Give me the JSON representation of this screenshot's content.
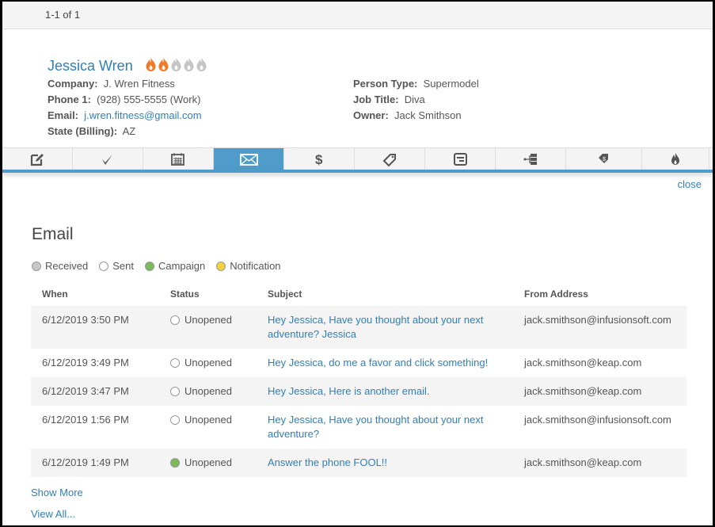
{
  "pager": "1-1 of 1",
  "contact": {
    "name": "Jessica Wren",
    "score": 2,
    "score_max": 5,
    "left": [
      {
        "label": "Company:",
        "value": "J. Wren Fitness"
      },
      {
        "label": "Phone 1:",
        "value": "(928) 555-5555 (Work)"
      },
      {
        "label": "Email:",
        "value": "j.wren.fitness@gmail.com",
        "link": true
      },
      {
        "label": "State (Billing):",
        "value": "AZ"
      }
    ],
    "right": [
      {
        "label": "Person Type:",
        "value": "Supermodel"
      },
      {
        "label": "Job Title:",
        "value": "Diva"
      },
      {
        "label": "Owner:",
        "value": "Jack Smithson"
      }
    ]
  },
  "tabs": [
    "note",
    "task",
    "appointment",
    "email",
    "payment",
    "tag",
    "form",
    "sequence",
    "promo",
    "score"
  ],
  "active_tab": "email",
  "close": "close",
  "email": {
    "title": "Email",
    "legend": [
      {
        "label": "Received",
        "color": "#c8c8c8"
      },
      {
        "label": "Sent",
        "color": "#ffffff"
      },
      {
        "label": "Campaign",
        "color": "#7cb95b"
      },
      {
        "label": "Notification",
        "color": "#f2d23a"
      }
    ],
    "columns": [
      "When",
      "Status",
      "Subject",
      "From Address"
    ],
    "rows": [
      {
        "when": "6/12/2019 3:50 PM",
        "status": "Unopened",
        "dot": "#ffffff",
        "subject": "Hey Jessica, Have you thought about your next adventure? Jessica",
        "from": "jack.smithson@infusionsoft.com"
      },
      {
        "when": "6/12/2019 3:49 PM",
        "status": "Unopened",
        "dot": "#ffffff",
        "subject": "Hey Jessica, do me a favor and click something!",
        "from": "jack.smithson@keap.com"
      },
      {
        "when": "6/12/2019 3:47 PM",
        "status": "Unopened",
        "dot": "#ffffff",
        "subject": "Hey Jessica, Here is another email.",
        "from": "jack.smithson@keap.com"
      },
      {
        "when": "6/12/2019 1:56 PM",
        "status": "Unopened",
        "dot": "#ffffff",
        "subject": "Hey Jessica, Have you thought about your next adventure?",
        "from": "jack.smithson@infusionsoft.com"
      },
      {
        "when": "6/12/2019 1:49 PM",
        "status": "Unopened",
        "dot": "#7cb95b",
        "subject": "Answer the phone FOOL!!",
        "from": "jack.smithson@keap.com"
      }
    ],
    "show_more": "Show More",
    "view_all": "View All..."
  }
}
